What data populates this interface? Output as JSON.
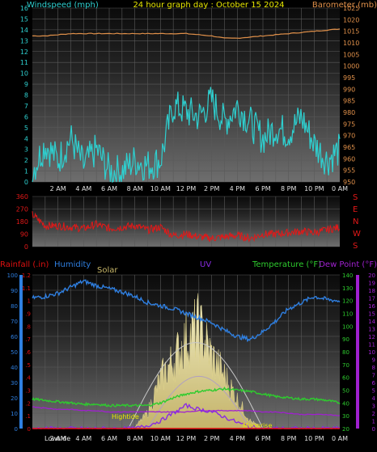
{
  "header": {
    "windspeed_label": "Windspeed (mph)",
    "title": "24 hour graph day : October 15 2024",
    "barometer_label": "Barometer (mb)"
  },
  "panel3_labels": {
    "rainfall": "Rainfall (.in)",
    "humidity": "Humidity",
    "solar": "Solar",
    "uv": "UV",
    "temperature": "Temperature (°F)",
    "dewpoint": "Dew Point (°F)",
    "hightide": "Hightide",
    "lowside": "Lowside",
    "moonrise": "Moonrise"
  },
  "colors": {
    "wind": "#2ed0d0",
    "barometer": "#e0904a",
    "direction": "#e31818",
    "humidity": "#2f7fe0",
    "temperature": "#2ecc2e",
    "dewpoint": "#a020d0",
    "solar": "#f0e8a8",
    "rain": "#e01010",
    "uv": "#8a2be2",
    "title": "#e8e800",
    "grid": "#5a5a5a"
  },
  "x_ticks": [
    "2 AM",
    "4 AM",
    "6 AM",
    "8 AM",
    "10 AM",
    "12 PM",
    "2 PM",
    "4 PM",
    "6 PM",
    "8 PM",
    "10 PM",
    "0 AM"
  ],
  "chart_data": [
    {
      "type": "line",
      "title": "24 hour graph day : October 15 2024",
      "xlabel": "",
      "ylabel_left": "Windspeed (mph)",
      "ylabel_right": "Barometer (mb)",
      "x_hours": [
        0,
        1,
        2,
        3,
        4,
        5,
        6,
        7,
        8,
        9,
        10,
        11,
        12,
        13,
        14,
        15,
        16,
        17,
        18,
        19,
        20,
        21,
        22,
        23,
        24
      ],
      "y_left_range": [
        0,
        16
      ],
      "y_left_ticks": [
        0,
        1,
        2,
        3,
        4,
        5,
        6,
        7,
        8,
        9,
        10,
        11,
        12,
        13,
        14,
        15,
        16
      ],
      "y_right_range": [
        950,
        1025
      ],
      "y_right_ticks": [
        950,
        955,
        960,
        965,
        970,
        975,
        980,
        985,
        990,
        995,
        1000,
        1005,
        1010,
        1015,
        1020,
        1025
      ],
      "series": [
        {
          "name": "Windspeed (mph)",
          "axis": "left",
          "values": [
            1.0,
            3.5,
            2.0,
            4.0,
            1.5,
            3.0,
            1.0,
            1.0,
            2.0,
            1.5,
            2.0,
            7.0,
            6.5,
            6.0,
            7.5,
            5.5,
            7.0,
            5.5,
            4.0,
            5.0,
            4.5,
            6.0,
            3.5,
            2.0,
            3.0
          ]
        },
        {
          "name": "Barometer (mb)",
          "axis": "right",
          "values": [
            1013,
            1013,
            1013.5,
            1014,
            1014,
            1014,
            1014,
            1014,
            1014,
            1014,
            1014,
            1014,
            1014,
            1013.5,
            1013,
            1012,
            1012,
            1012.5,
            1013,
            1013.5,
            1014,
            1014.5,
            1015,
            1015.5,
            1016
          ]
        }
      ]
    },
    {
      "type": "line",
      "title": "",
      "ylabel_right": [
        "S",
        "E",
        "N",
        "W",
        "S"
      ],
      "x_hours": [
        0,
        1,
        2,
        3,
        4,
        5,
        6,
        7,
        8,
        9,
        10,
        11,
        12,
        13,
        14,
        15,
        16,
        17,
        18,
        19,
        20,
        21,
        22,
        23,
        24
      ],
      "y_range": [
        0,
        360
      ],
      "y_ticks": [
        0,
        90,
        180,
        270,
        360
      ],
      "series": [
        {
          "name": "Wind direction",
          "values": [
            230,
            150,
            150,
            140,
            130,
            160,
            130,
            140,
            150,
            120,
            140,
            80,
            90,
            70,
            60,
            70,
            80,
            60,
            90,
            90,
            100,
            110,
            100,
            120,
            140
          ]
        }
      ]
    },
    {
      "type": "line",
      "title": "",
      "x_hours": [
        0,
        1,
        2,
        3,
        4,
        5,
        6,
        7,
        8,
        9,
        10,
        11,
        12,
        13,
        14,
        15,
        16,
        17,
        18,
        19,
        20,
        21,
        22,
        23,
        24
      ],
      "axes": {
        "humidity": {
          "range": [
            0,
            100
          ],
          "ticks": [
            0,
            10,
            20,
            30,
            40,
            50,
            60,
            70,
            80,
            90,
            100
          ]
        },
        "rainfall": {
          "range": [
            0,
            1.2
          ],
          "ticks": [
            0,
            0.1,
            0.2,
            0.3,
            0.4,
            0.5,
            0.6,
            0.7,
            0.8,
            0.9,
            1,
            1.1,
            1.2
          ]
        },
        "temperature": {
          "range": [
            20,
            140
          ],
          "ticks": [
            20,
            30,
            40,
            50,
            60,
            70,
            80,
            90,
            100,
            110,
            120,
            130,
            140
          ]
        },
        "uv": {
          "range": [
            0,
            20
          ],
          "ticks": [
            0,
            1,
            2,
            3,
            4,
            5,
            6,
            7,
            8,
            9,
            10,
            11,
            12,
            13,
            14,
            15,
            16,
            17,
            18,
            19,
            20
          ]
        }
      },
      "series": [
        {
          "name": "Humidity",
          "axis": "humidity",
          "values": [
            85,
            86,
            88,
            92,
            96,
            93,
            91,
            89,
            86,
            82,
            80,
            78,
            75,
            72,
            69,
            64,
            60,
            58,
            63,
            70,
            78,
            82,
            86,
            84,
            83
          ]
        },
        {
          "name": "Temperature (°F)",
          "axis": "temperature",
          "values": [
            43,
            42,
            41,
            40,
            39,
            39,
            38,
            38,
            38,
            38,
            40,
            44,
            47,
            49,
            50,
            51,
            50,
            49,
            47,
            45,
            44,
            43,
            43,
            42,
            40
          ]
        },
        {
          "name": "Dew Point (°F)",
          "axis": "temperature",
          "values": [
            37,
            36,
            35,
            35,
            34,
            34,
            33,
            33,
            33,
            33,
            33,
            33,
            33,
            34,
            34,
            34,
            34,
            34,
            33,
            33,
            32,
            31,
            31,
            31,
            30
          ]
        },
        {
          "name": "Solar",
          "axis": "humidity",
          "values": [
            0,
            0,
            0,
            0,
            0,
            0,
            0,
            0,
            1,
            12,
            38,
            52,
            68,
            78,
            55,
            40,
            22,
            6,
            0,
            0,
            0,
            0,
            0,
            0,
            0
          ]
        },
        {
          "name": "UV",
          "axis": "uv",
          "values": [
            0,
            0,
            0,
            0,
            0,
            0,
            0,
            0,
            0,
            0.4,
            1.0,
            2.0,
            3.0,
            2.5,
            2.2,
            1.5,
            0.8,
            0.2,
            0,
            0,
            0,
            0,
            0,
            0,
            0
          ]
        },
        {
          "name": "Rainfall (.in)",
          "axis": "rainfall",
          "values": [
            0,
            0,
            0,
            0,
            0,
            0,
            0,
            0,
            0,
            0,
            0,
            0,
            0,
            0,
            0,
            0,
            0,
            0,
            0,
            0,
            0,
            0,
            0,
            0,
            0
          ]
        }
      ]
    }
  ]
}
